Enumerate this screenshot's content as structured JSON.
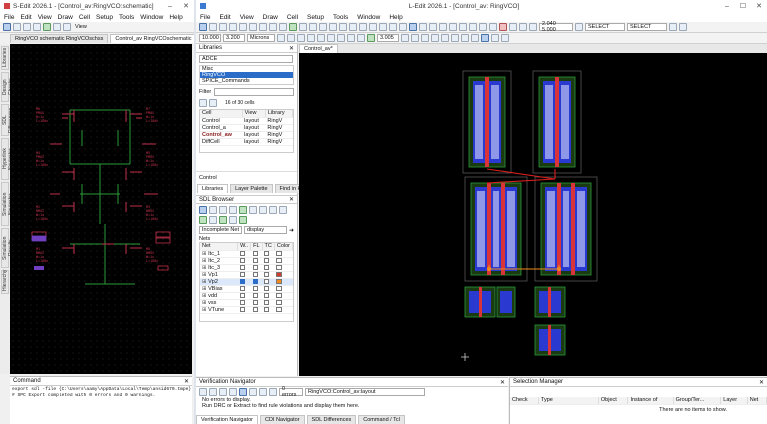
{
  "schematic_window": {
    "title": "S-Edit 2026.1 - [Control_av:RingVCO:schematic]",
    "menu": [
      "File",
      "Edit",
      "View",
      "Draw",
      "Cell",
      "Setup",
      "Tools",
      "Window",
      "Help"
    ],
    "view_label": "View",
    "tabs": [
      "RingVCO schematic RingVCOschss",
      "Control_av RingVCOschematic"
    ],
    "side_tabs": [
      "Libraries",
      "Design Checks",
      "SDL Differences",
      "Hyperlink Navigator",
      "Simulation Navigator",
      "Simulation Results",
      "Hierarchy"
    ],
    "command": {
      "title": "Command",
      "line1": "export sdl -file {C:\\Users\\aamy\\AppData\\Local\\Temp\\ansid670.tmpe}",
      "line2": "# SPC  Export completed with 0 errors and 0 warnings."
    }
  },
  "layout_window": {
    "title": "L-Edit 2026.1 - [Control_av: RingVCO]",
    "menu": [
      "File",
      "Edit",
      "View",
      "Draw",
      "Cell",
      "Setup",
      "Tools",
      "Window",
      "Help"
    ],
    "toolbar": {
      "coord_a": "10.000",
      "coord_b": "3.200",
      "grid_mode": "Microns",
      "value_1": "3.005",
      "coords": "2.040 5.000",
      "select_1": "SELECT",
      "select_2": "SELECT"
    },
    "libraries": {
      "title": "Libraries",
      "library_name": "ADCE",
      "lib_items": [
        "Misc",
        "RingVCO",
        "SPICE_Commands"
      ],
      "selected_lib": "RingVCO",
      "filter_label": "Filter",
      "filter_count": "16 of 30 cells",
      "columns": [
        "Cell",
        "View",
        "Library"
      ],
      "rows": [
        {
          "cell": "Control",
          "view": "layout",
          "library": "RingV"
        },
        {
          "cell": "Control_a",
          "view": "layout",
          "library": "RingV"
        },
        {
          "cell": "Control_aw",
          "view": "layout",
          "library": "RingV"
        },
        {
          "cell": "DiffCell",
          "view": "layout",
          "library": "RingV"
        }
      ],
      "current_cell": "Control",
      "tabs": [
        "Libraries",
        "Layer Palette",
        "Find in Hierarchy"
      ]
    },
    "sdl_browser": {
      "title": "SDL Browser",
      "filter_label": "Incomplete Net",
      "filter_value": "display",
      "nets_label": "Nets",
      "columns": [
        "Net",
        "W..",
        "FL",
        "TC",
        "Color"
      ],
      "nets": [
        {
          "name": "Itc_1",
          "w": false,
          "fl": false,
          "tc": false,
          "color": ""
        },
        {
          "name": "Itc_2",
          "w": false,
          "fl": false,
          "tc": false,
          "color": ""
        },
        {
          "name": "Itc_3",
          "w": false,
          "fl": false,
          "tc": false,
          "color": ""
        },
        {
          "name": "Vp1",
          "w": false,
          "fl": false,
          "tc": false,
          "color": "#d23a2a"
        },
        {
          "name": "Vp2",
          "w": true,
          "fl": true,
          "tc": false,
          "color": "#f08a1e"
        },
        {
          "name": "VBias",
          "w": false,
          "fl": false,
          "tc": false,
          "color": ""
        },
        {
          "name": "vdd",
          "w": false,
          "fl": false,
          "tc": false,
          "color": ""
        },
        {
          "name": "vss",
          "w": false,
          "fl": false,
          "tc": false,
          "color": ""
        },
        {
          "name": "VTune",
          "w": false,
          "fl": false,
          "tc": false,
          "color": ""
        }
      ]
    },
    "canvas_tab": "Control_av*",
    "verification": {
      "title": "Verification Navigator",
      "errors_label": "0 errors",
      "path": "RingVCO:Control_av:layout",
      "msg1": "No errors to display.",
      "msg2": "Run DRC or Extract to find rule violations and display them here.",
      "tabs": [
        "Verification Navigator",
        "CDI Navigator",
        "SDL Differences",
        "Command / Tcl"
      ]
    },
    "selection": {
      "title": "Selection Manager",
      "columns": [
        "Check",
        "Type",
        "Object",
        "Instance of",
        "Group/Ter...",
        "Layer",
        "Net"
      ],
      "empty": "There are no items to show."
    }
  },
  "colors": {
    "schematic_wire": "#c0304a",
    "net_highlight": "#2b9a3a",
    "poly": "#d8343a",
    "diffusion": "#2a3ad0",
    "metal": "#a8a0c8"
  }
}
